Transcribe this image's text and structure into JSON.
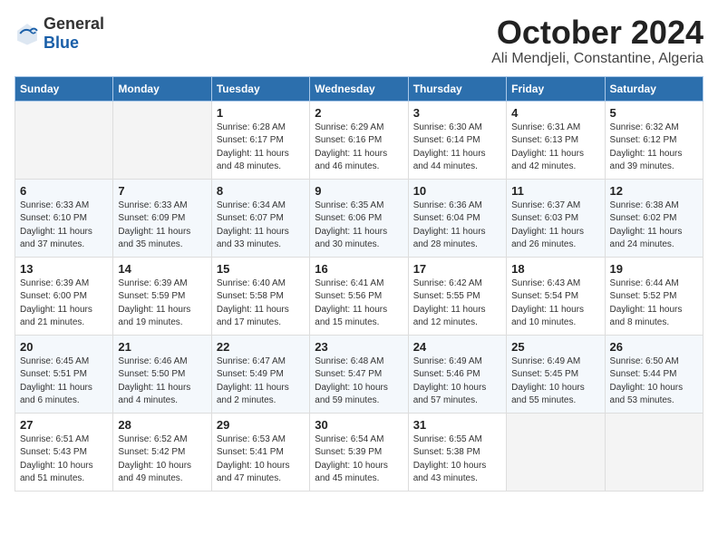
{
  "header": {
    "logo_general": "General",
    "logo_blue": "Blue",
    "month": "October 2024",
    "location": "Ali Mendjeli, Constantine, Algeria"
  },
  "days_of_week": [
    "Sunday",
    "Monday",
    "Tuesday",
    "Wednesday",
    "Thursday",
    "Friday",
    "Saturday"
  ],
  "weeks": [
    [
      {
        "day": "",
        "sunrise": "",
        "sunset": "",
        "daylight": ""
      },
      {
        "day": "",
        "sunrise": "",
        "sunset": "",
        "daylight": ""
      },
      {
        "day": "1",
        "sunrise": "Sunrise: 6:28 AM",
        "sunset": "Sunset: 6:17 PM",
        "daylight": "Daylight: 11 hours and 48 minutes."
      },
      {
        "day": "2",
        "sunrise": "Sunrise: 6:29 AM",
        "sunset": "Sunset: 6:16 PM",
        "daylight": "Daylight: 11 hours and 46 minutes."
      },
      {
        "day": "3",
        "sunrise": "Sunrise: 6:30 AM",
        "sunset": "Sunset: 6:14 PM",
        "daylight": "Daylight: 11 hours and 44 minutes."
      },
      {
        "day": "4",
        "sunrise": "Sunrise: 6:31 AM",
        "sunset": "Sunset: 6:13 PM",
        "daylight": "Daylight: 11 hours and 42 minutes."
      },
      {
        "day": "5",
        "sunrise": "Sunrise: 6:32 AM",
        "sunset": "Sunset: 6:12 PM",
        "daylight": "Daylight: 11 hours and 39 minutes."
      }
    ],
    [
      {
        "day": "6",
        "sunrise": "Sunrise: 6:33 AM",
        "sunset": "Sunset: 6:10 PM",
        "daylight": "Daylight: 11 hours and 37 minutes."
      },
      {
        "day": "7",
        "sunrise": "Sunrise: 6:33 AM",
        "sunset": "Sunset: 6:09 PM",
        "daylight": "Daylight: 11 hours and 35 minutes."
      },
      {
        "day": "8",
        "sunrise": "Sunrise: 6:34 AM",
        "sunset": "Sunset: 6:07 PM",
        "daylight": "Daylight: 11 hours and 33 minutes."
      },
      {
        "day": "9",
        "sunrise": "Sunrise: 6:35 AM",
        "sunset": "Sunset: 6:06 PM",
        "daylight": "Daylight: 11 hours and 30 minutes."
      },
      {
        "day": "10",
        "sunrise": "Sunrise: 6:36 AM",
        "sunset": "Sunset: 6:04 PM",
        "daylight": "Daylight: 11 hours and 28 minutes."
      },
      {
        "day": "11",
        "sunrise": "Sunrise: 6:37 AM",
        "sunset": "Sunset: 6:03 PM",
        "daylight": "Daylight: 11 hours and 26 minutes."
      },
      {
        "day": "12",
        "sunrise": "Sunrise: 6:38 AM",
        "sunset": "Sunset: 6:02 PM",
        "daylight": "Daylight: 11 hours and 24 minutes."
      }
    ],
    [
      {
        "day": "13",
        "sunrise": "Sunrise: 6:39 AM",
        "sunset": "Sunset: 6:00 PM",
        "daylight": "Daylight: 11 hours and 21 minutes."
      },
      {
        "day": "14",
        "sunrise": "Sunrise: 6:39 AM",
        "sunset": "Sunset: 5:59 PM",
        "daylight": "Daylight: 11 hours and 19 minutes."
      },
      {
        "day": "15",
        "sunrise": "Sunrise: 6:40 AM",
        "sunset": "Sunset: 5:58 PM",
        "daylight": "Daylight: 11 hours and 17 minutes."
      },
      {
        "day": "16",
        "sunrise": "Sunrise: 6:41 AM",
        "sunset": "Sunset: 5:56 PM",
        "daylight": "Daylight: 11 hours and 15 minutes."
      },
      {
        "day": "17",
        "sunrise": "Sunrise: 6:42 AM",
        "sunset": "Sunset: 5:55 PM",
        "daylight": "Daylight: 11 hours and 12 minutes."
      },
      {
        "day": "18",
        "sunrise": "Sunrise: 6:43 AM",
        "sunset": "Sunset: 5:54 PM",
        "daylight": "Daylight: 11 hours and 10 minutes."
      },
      {
        "day": "19",
        "sunrise": "Sunrise: 6:44 AM",
        "sunset": "Sunset: 5:52 PM",
        "daylight": "Daylight: 11 hours and 8 minutes."
      }
    ],
    [
      {
        "day": "20",
        "sunrise": "Sunrise: 6:45 AM",
        "sunset": "Sunset: 5:51 PM",
        "daylight": "Daylight: 11 hours and 6 minutes."
      },
      {
        "day": "21",
        "sunrise": "Sunrise: 6:46 AM",
        "sunset": "Sunset: 5:50 PM",
        "daylight": "Daylight: 11 hours and 4 minutes."
      },
      {
        "day": "22",
        "sunrise": "Sunrise: 6:47 AM",
        "sunset": "Sunset: 5:49 PM",
        "daylight": "Daylight: 11 hours and 2 minutes."
      },
      {
        "day": "23",
        "sunrise": "Sunrise: 6:48 AM",
        "sunset": "Sunset: 5:47 PM",
        "daylight": "Daylight: 10 hours and 59 minutes."
      },
      {
        "day": "24",
        "sunrise": "Sunrise: 6:49 AM",
        "sunset": "Sunset: 5:46 PM",
        "daylight": "Daylight: 10 hours and 57 minutes."
      },
      {
        "day": "25",
        "sunrise": "Sunrise: 6:49 AM",
        "sunset": "Sunset: 5:45 PM",
        "daylight": "Daylight: 10 hours and 55 minutes."
      },
      {
        "day": "26",
        "sunrise": "Sunrise: 6:50 AM",
        "sunset": "Sunset: 5:44 PM",
        "daylight": "Daylight: 10 hours and 53 minutes."
      }
    ],
    [
      {
        "day": "27",
        "sunrise": "Sunrise: 6:51 AM",
        "sunset": "Sunset: 5:43 PM",
        "daylight": "Daylight: 10 hours and 51 minutes."
      },
      {
        "day": "28",
        "sunrise": "Sunrise: 6:52 AM",
        "sunset": "Sunset: 5:42 PM",
        "daylight": "Daylight: 10 hours and 49 minutes."
      },
      {
        "day": "29",
        "sunrise": "Sunrise: 6:53 AM",
        "sunset": "Sunset: 5:41 PM",
        "daylight": "Daylight: 10 hours and 47 minutes."
      },
      {
        "day": "30",
        "sunrise": "Sunrise: 6:54 AM",
        "sunset": "Sunset: 5:39 PM",
        "daylight": "Daylight: 10 hours and 45 minutes."
      },
      {
        "day": "31",
        "sunrise": "Sunrise: 6:55 AM",
        "sunset": "Sunset: 5:38 PM",
        "daylight": "Daylight: 10 hours and 43 minutes."
      },
      {
        "day": "",
        "sunrise": "",
        "sunset": "",
        "daylight": ""
      },
      {
        "day": "",
        "sunrise": "",
        "sunset": "",
        "daylight": ""
      }
    ]
  ]
}
